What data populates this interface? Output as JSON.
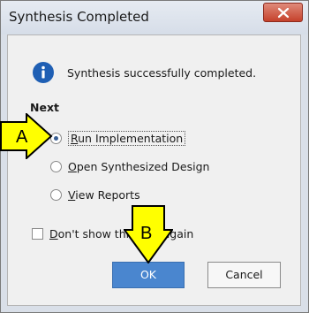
{
  "dialog": {
    "title": "Synthesis Completed",
    "message": "Synthesis successfully completed.",
    "section_label": "Next",
    "options": [
      {
        "prefix": "",
        "accel": "R",
        "rest": "un Implementation",
        "checked": true
      },
      {
        "prefix": "",
        "accel": "O",
        "rest": "pen Synthesized Design",
        "checked": false
      },
      {
        "prefix": "",
        "accel": "V",
        "rest": "iew Reports",
        "checked": false
      }
    ],
    "dont_show": {
      "accel": "D",
      "rest": "on't show this",
      "tail": "again",
      "checked": false
    },
    "ok_label": "OK",
    "cancel_label": "Cancel"
  },
  "annotations": {
    "a_label": "A",
    "b_label": "B"
  },
  "colors": {
    "accent": "#4a86cf",
    "callout_fill": "#ffff00",
    "close_red": "#c5412b"
  },
  "icons": {
    "info": "info-icon",
    "close": "close-icon"
  }
}
